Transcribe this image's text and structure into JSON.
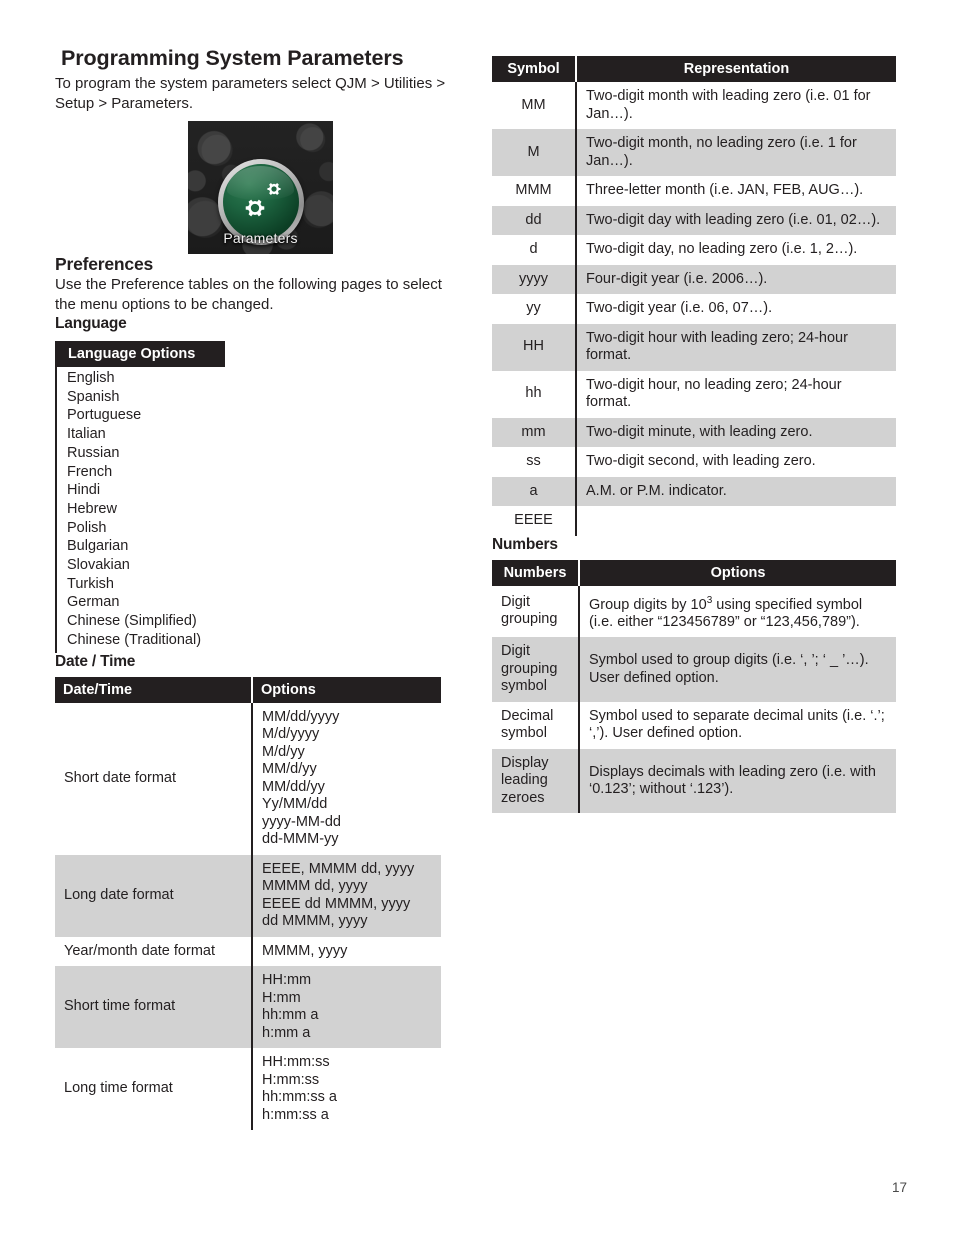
{
  "document": {
    "page_number": "17"
  },
  "left": {
    "title": "Programming System Parameters",
    "intro": "To program the system parameters select  QJM > Utilities > Setup > Parameters.",
    "icon": {
      "name": "parameters-icon",
      "label": "Parameters"
    },
    "preferences": {
      "heading": "Preferences",
      "text": "Use the Preference tables on the following pages to select the menu options to be changed."
    },
    "language": {
      "heading": "Language",
      "table_header": "Language Options",
      "options": [
        "English",
        "Spanish",
        "Portuguese",
        "Italian",
        "Russian",
        "French",
        "Hindi",
        "Hebrew",
        "Polish",
        "Bulgarian",
        "Slovakian",
        "Turkish",
        "German",
        "Chinese (Simplified)",
        "Chinese (Traditional)"
      ]
    },
    "datetime": {
      "heading": "Date / Time",
      "columns": [
        "Date/Time",
        "Options"
      ],
      "rows": [
        {
          "label": "Short date format",
          "options": "MM/dd/yyyy\nM/d/yyyy\nM/d/yy\nMM/d/yy\nMM/dd/yy\nYy/MM/dd\nyyyy-MM-dd\ndd-MMM-yy",
          "shaded": false
        },
        {
          "label": "Long date format",
          "options": "EEEE, MMMM dd, yyyy\nMMMM dd, yyyy\nEEEE dd MMMM, yyyy\ndd MMMM, yyyy",
          "shaded": true
        },
        {
          "label": "Year/month date format",
          "options": "MMMM, yyyy",
          "shaded": false
        },
        {
          "label": "Short time format",
          "options": "HH:mm\nH:mm\nhh:mm a\nh:mm a",
          "shaded": true
        },
        {
          "label": "Long time format",
          "options": "HH:mm:ss\nH:mm:ss\nhh:mm:ss a\nh:mm:ss a",
          "shaded": false
        }
      ]
    }
  },
  "right": {
    "symbols": {
      "columns": [
        "Symbol",
        "Representation"
      ],
      "rows": [
        {
          "symbol": "MM",
          "representation": "Two-digit month with leading zero (i.e. 01 for Jan…).",
          "shaded": false
        },
        {
          "symbol": "M",
          "representation": "Two-digit month, no leading zero (i.e. 1 for Jan…).",
          "shaded": true
        },
        {
          "symbol": "MMM",
          "representation": "Three-letter month (i.e. JAN, FEB, AUG…).",
          "shaded": false
        },
        {
          "symbol": "dd",
          "representation": "Two-digit day with leading zero (i.e. 01, 02…).",
          "shaded": true
        },
        {
          "symbol": "d",
          "representation": "Two-digit day, no leading zero (i.e. 1, 2…).",
          "shaded": false
        },
        {
          "symbol": "yyyy",
          "representation": "Four-digit year (i.e. 2006…).",
          "shaded": true
        },
        {
          "symbol": "yy",
          "representation": "Two-digit year (i.e. 06, 07…).",
          "shaded": false
        },
        {
          "symbol": "HH",
          "representation": "Two-digit hour with leading zero; 24-hour format.",
          "shaded": true
        },
        {
          "symbol": "hh",
          "representation": "Two-digit hour, no leading zero; 24-hour format.",
          "shaded": false
        },
        {
          "symbol": "mm",
          "representation": "Two-digit minute, with leading zero.",
          "shaded": true
        },
        {
          "symbol": "ss",
          "representation": "Two-digit second, with leading zero.",
          "shaded": false
        },
        {
          "symbol": "a",
          "representation": "A.M. or P.M. indicator.",
          "shaded": true
        },
        {
          "symbol": "EEEE",
          "representation": "",
          "shaded": false
        }
      ]
    },
    "numbers": {
      "heading": "Numbers",
      "columns": [
        "Numbers",
        "Options"
      ],
      "rows": [
        {
          "label": "Digit grouping",
          "option_pre": "Group digits by 10",
          "option_sup": "3",
          "option_post": " using specified symbol (i.e. either “123456789” or “123,456,789”).",
          "shaded": false
        },
        {
          "label": "Digit grouping symbol",
          "option": "Symbol used to group digits (i.e. ‘, ’; ‘ _ ’…). User defined option.",
          "shaded": true
        },
        {
          "label": "Decimal symbol",
          "option": "Symbol used to separate decimal units (i.e. ‘.’; ‘,’). User defined option.",
          "shaded": false
        },
        {
          "label": "Display leading zeroes",
          "option": "Displays decimals with leading zero (i.e. with ‘0.123’; without ‘.123’).",
          "shaded": true
        }
      ]
    }
  }
}
